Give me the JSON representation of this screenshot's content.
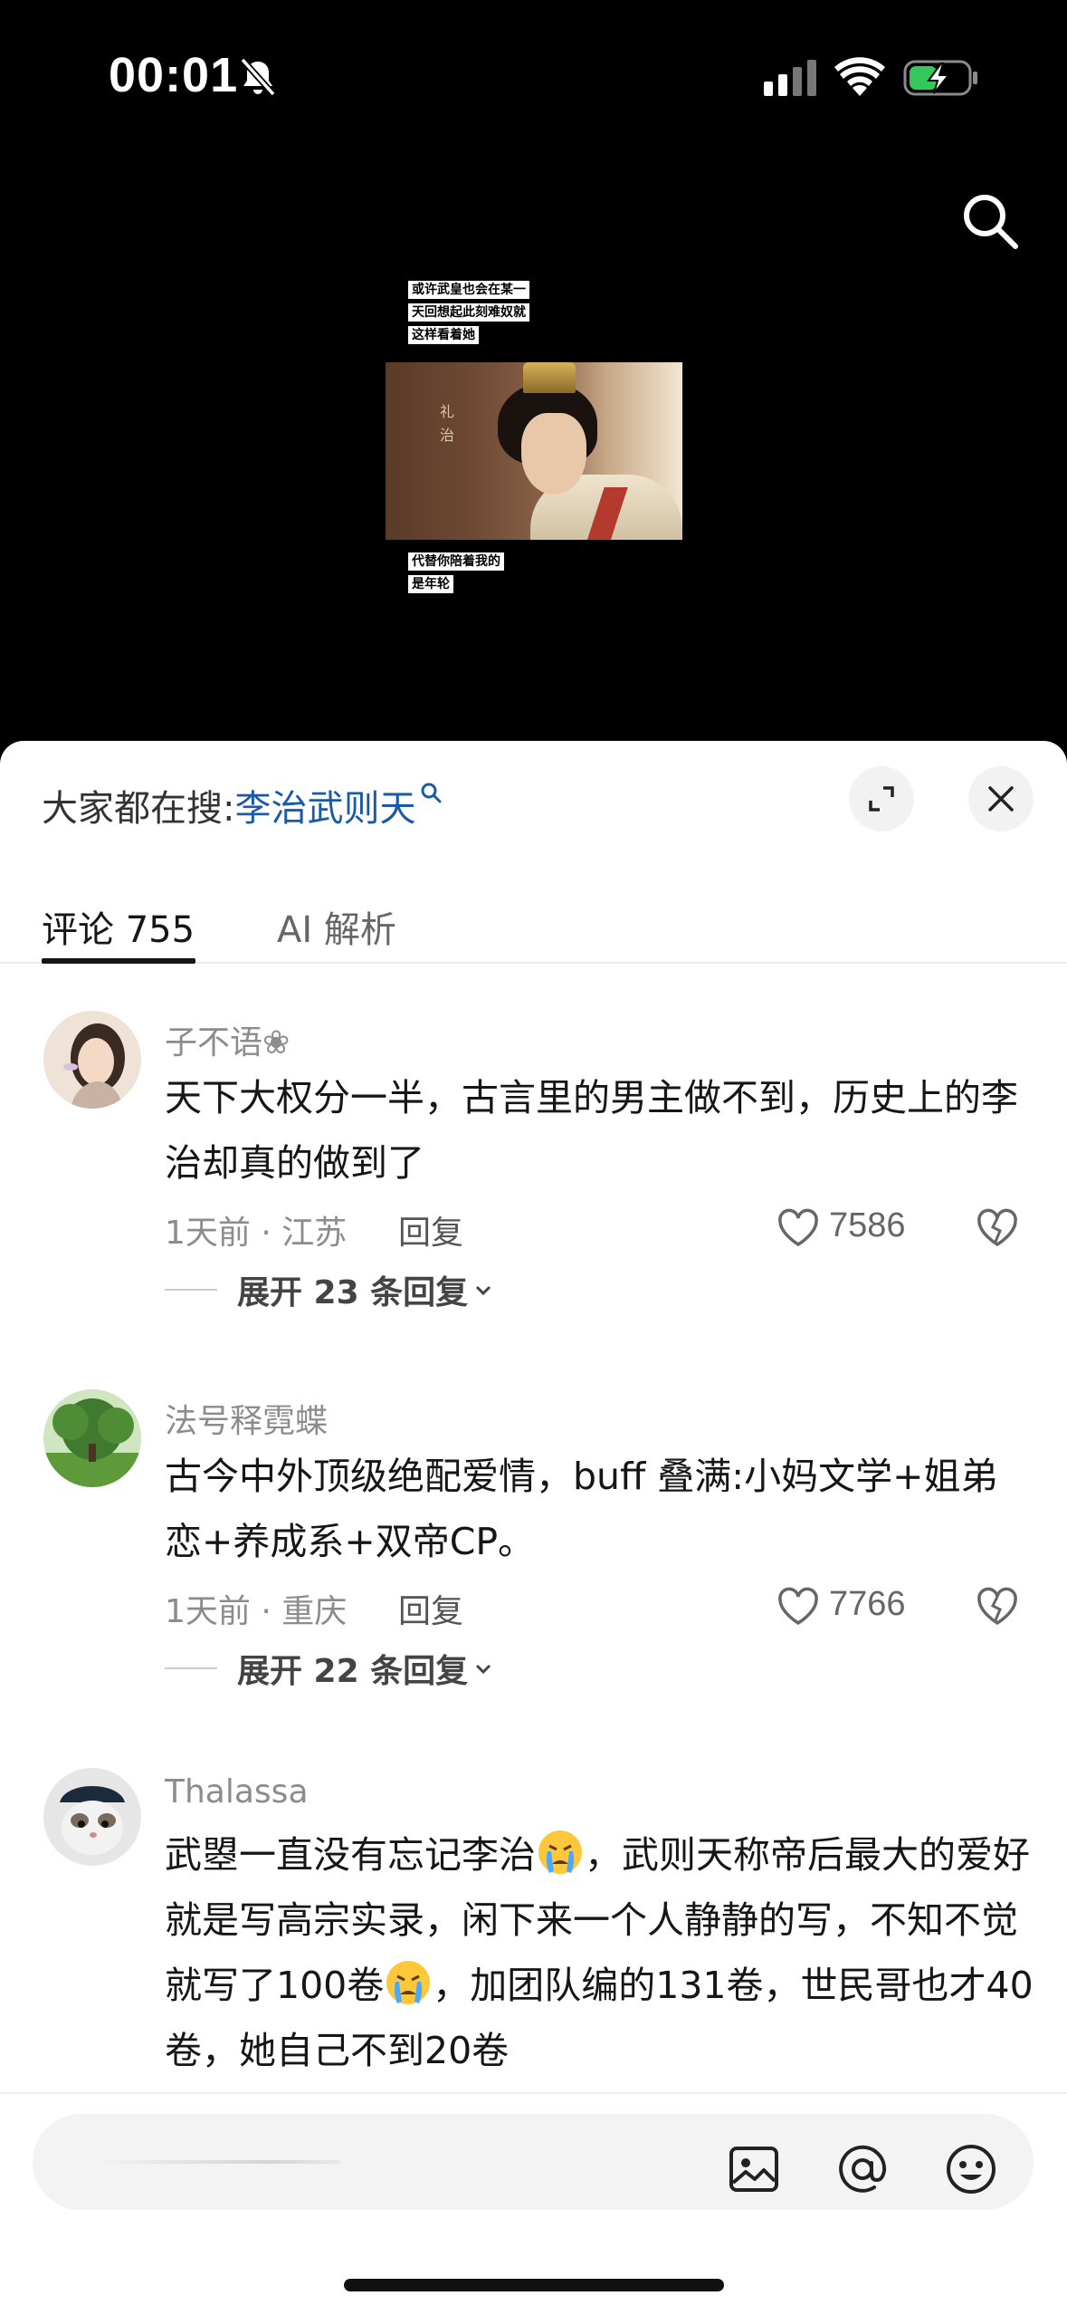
{
  "status_bar": {
    "time": "00:01"
  },
  "video": {
    "subtitle_top": [
      "或许武皇也会在某一",
      "天回想起此刻难奴就",
      "这样看着她"
    ],
    "subtitle_bottom": [
      "代替你陪着我的",
      "是年轮"
    ],
    "wall_text": "礼治"
  },
  "search_hint": {
    "prefix": "大家都在搜:",
    "keyword": "李治武则天"
  },
  "tabs": [
    {
      "label": "评论 755"
    },
    {
      "label": "AI 解析"
    }
  ],
  "comments": [
    {
      "author": "子不语❀",
      "text": "天下大权分一半，古言里的男主做不到，历史上的李治却真的做到了",
      "meta": "1天前 · 江苏",
      "reply_label": "回复",
      "likes": "7586",
      "expand_label": "展开 23 条回复"
    },
    {
      "author": "法号释霓蝶",
      "text": "古今中外顶级绝配爱情，buff 叠满:小妈文学+姐弟恋+养成系+双帝CP。",
      "meta": "1天前 · 重庆",
      "reply_label": "回复",
      "likes": "7766",
      "expand_label": "展开 22 条回复"
    },
    {
      "author": "Thalassa",
      "text_parts": [
        "武曌一直没有忘记李治",
        "，武则天称帝后最大的爱好就是写高宗实录，闲下来一个人静静的写，不知不觉就写了100卷",
        "，加团队编的131卷，世民哥也才40卷，她自己不到20卷"
      ]
    }
  ],
  "input": {
    "placeholder": ""
  },
  "colors": {
    "keyword": "#1a5aa8",
    "sheet_bg": "#ffffff",
    "video_bg": "#000000"
  }
}
